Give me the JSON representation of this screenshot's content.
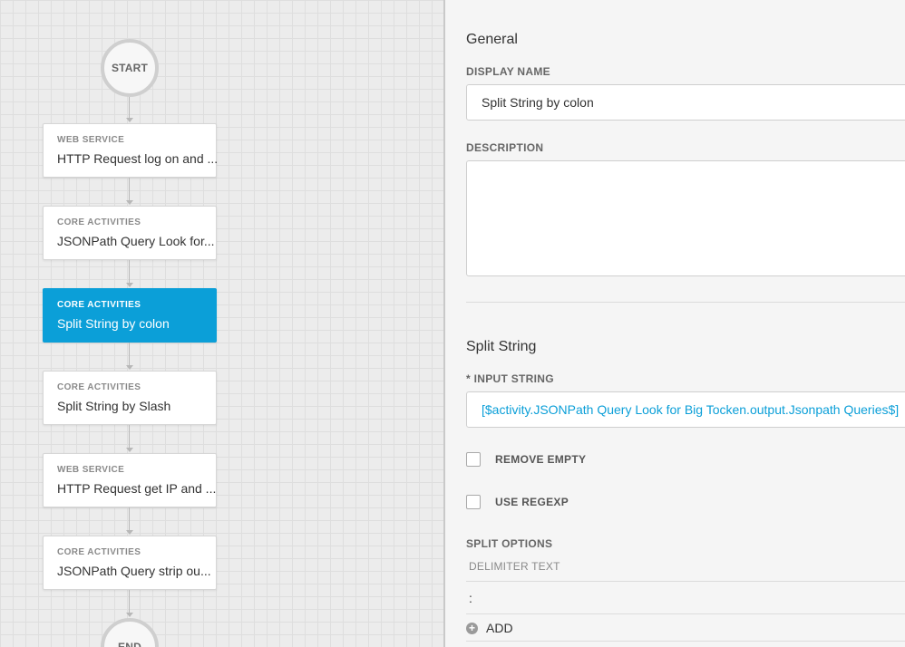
{
  "flow": {
    "start_label": "START",
    "end_label": "END",
    "nodes": [
      {
        "category": "WEB SERVICE",
        "title": "HTTP Request log on and ..."
      },
      {
        "category": "CORE ACTIVITIES",
        "title": "JSONPath Query Look for..."
      },
      {
        "category": "CORE ACTIVITIES",
        "title": "Split String by colon"
      },
      {
        "category": "CORE ACTIVITIES",
        "title": "Split String by Slash"
      },
      {
        "category": "WEB SERVICE",
        "title": "HTTP Request get IP and ..."
      },
      {
        "category": "CORE ACTIVITIES",
        "title": "JSONPath Query strip ou..."
      }
    ]
  },
  "panel": {
    "general_title": "General",
    "display_name_label": "DISPLAY NAME",
    "display_name_value": "Split String by colon",
    "description_label": "DESCRIPTION",
    "description_value": "",
    "split_title": "Split String",
    "input_string_label": "* INPUT STRING",
    "input_string_value": "[$activity.JSONPath Query Look for Big Tocken.output.Jsonpath Queries$]",
    "remove_empty_label": "REMOVE EMPTY",
    "use_regexp_label": "USE REGEXP",
    "split_options_label": "SPLIT OPTIONS",
    "delimiter_header": "DELIMITER TEXT",
    "delimiter_value": ":",
    "add_label": "ADD"
  },
  "colors": {
    "accent": "#0b9fd8",
    "canvas_bg": "#ececec",
    "panel_bg": "#f5f5f5"
  }
}
